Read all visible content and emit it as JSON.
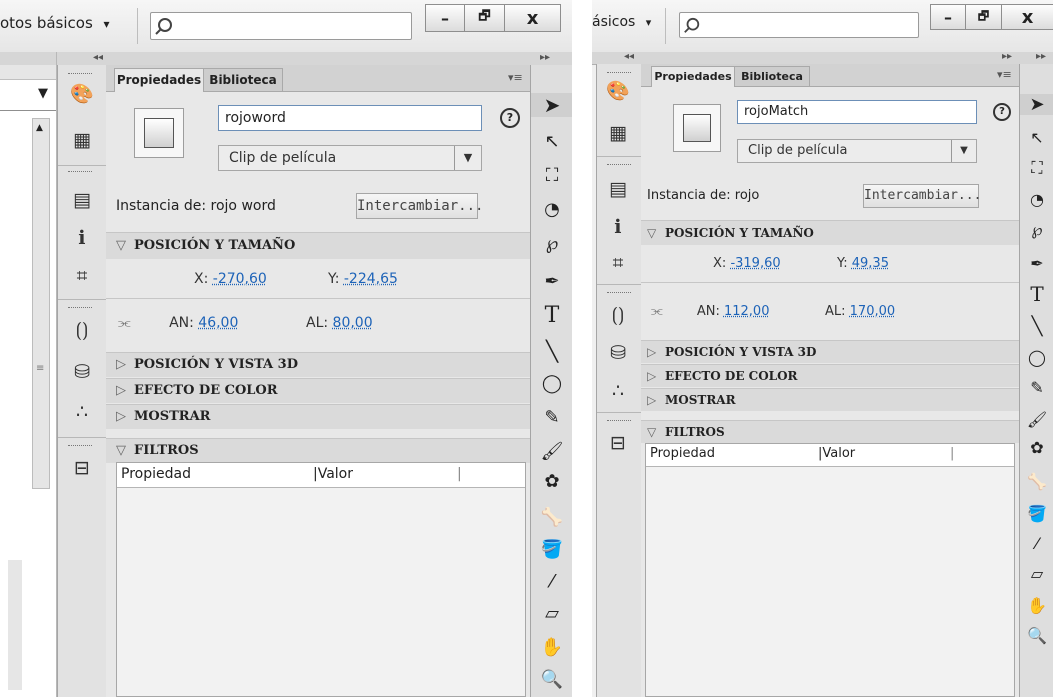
{
  "left": {
    "workspace_label": "otos básicos",
    "dropdown_arrow": "▾",
    "win_min": "–",
    "win_restore": "🗗",
    "win_close": "x",
    "collapse_left": "◂◂",
    "collapse_right": "▸▸",
    "tabs": [
      "Propiedades",
      "Biblioteca"
    ],
    "panel_menu": "▾≡",
    "instance_name": "rojoword",
    "symbol_type": "Clip de película",
    "instance_of_label": "Instancia de:",
    "instance_of_value": "rojo word",
    "swap_button": "Intercambiar...",
    "sections": {
      "pos_size": "POSICIÓN Y TAMAÑO",
      "pos_3d": "POSICIÓN Y VISTA 3D",
      "color_effect": "EFECTO DE COLOR",
      "display": "MOSTRAR",
      "filters": "FILTROS"
    },
    "x_label": "X:",
    "x_value": "-270,60",
    "y_label": "Y:",
    "y_value": "-224,65",
    "an_label": "AN:",
    "an_value": "46,00",
    "al_label": "AL:",
    "al_value": "80,00",
    "col_property": "Propiedad",
    "col_value": "Valor"
  },
  "right": {
    "workspace_label": "ásicos",
    "dropdown_arrow": "▾",
    "win_min": "–",
    "win_restore": "🗗",
    "win_close": "x",
    "collapse_left": "◂◂",
    "collapse_right": "▸▸",
    "tabs": [
      "Propiedades",
      "Biblioteca"
    ],
    "panel_menu": "▾≡",
    "instance_name": "rojoMatch",
    "symbol_type": "Clip de película",
    "instance_of_label": "Instancia de:",
    "instance_of_value": "rojo",
    "swap_button": "Intercambiar...",
    "sections": {
      "pos_size": "POSICIÓN Y TAMAÑO",
      "pos_3d": "POSICIÓN Y VISTA 3D",
      "color_effect": "EFECTO DE COLOR",
      "display": "MOSTRAR",
      "filters": "FILTROS"
    },
    "x_label": "X:",
    "x_value": "-319,60",
    "y_label": "Y:",
    "y_value": "49,35",
    "an_label": "AN:",
    "an_value": "112,00",
    "al_label": "AL:",
    "al_value": "170,00",
    "col_property": "Propiedad",
    "col_value": "Valor"
  },
  "glyphs": {
    "open": "▽",
    "closed": "▷",
    "help": "?",
    "link": "⫘"
  }
}
